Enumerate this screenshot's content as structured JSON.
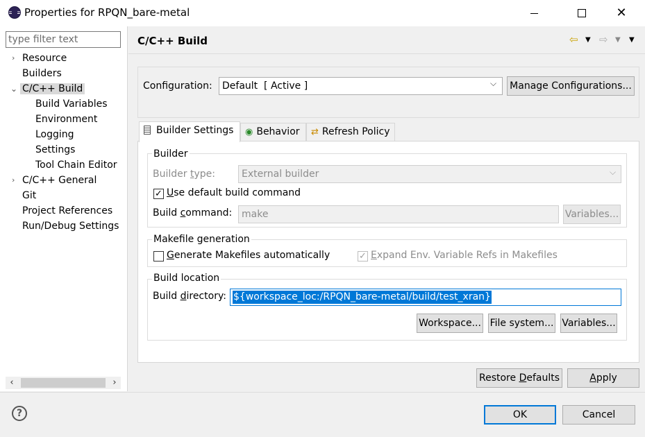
{
  "window": {
    "title": "Properties for RPQN_bare-metal",
    "minimize_icon": "minimize-icon",
    "maximize_icon": "maximize-icon",
    "close_icon": "close-icon"
  },
  "sidebar": {
    "filter_placeholder": "type filter text",
    "items": [
      {
        "label": "Resource",
        "expander": "collapsed"
      },
      {
        "label": "Builders"
      },
      {
        "label": "C/C++ Build",
        "expander": "expanded",
        "selected": true
      },
      {
        "label": "Build Variables"
      },
      {
        "label": "Environment"
      },
      {
        "label": "Logging"
      },
      {
        "label": "Settings"
      },
      {
        "label": "Tool Chain Editor"
      },
      {
        "label": "C/C++ General",
        "expander": "collapsed"
      },
      {
        "label": "Git"
      },
      {
        "label": "Project References"
      },
      {
        "label": "Run/Debug Settings"
      }
    ]
  },
  "page": {
    "title": "C/C++ Build"
  },
  "configuration": {
    "label": "Configuration:",
    "selected": "Default  [ Active ]",
    "manage_button": "Manage Configurations..."
  },
  "tabs": [
    {
      "label": "Builder Settings",
      "icon": "builder-settings-icon",
      "active": true
    },
    {
      "label": "Behavior",
      "icon": "behavior-icon"
    },
    {
      "label": "Refresh Policy",
      "icon": "refresh-policy-icon"
    }
  ],
  "builder": {
    "group_title": "Builder",
    "type_label_pre": "Builder ",
    "type_label_u": "t",
    "type_label_post": "ype:",
    "type_value": "External builder",
    "use_default_pre": "",
    "use_default_u": "U",
    "use_default_post": "se default build command",
    "use_default_checked": true,
    "command_label_pre": "Build ",
    "command_label_u": "c",
    "command_label_post": "ommand:",
    "command_value": "make",
    "variables_button": "Variables..."
  },
  "makefile": {
    "group_title": "Makefile generation",
    "generate_u": "G",
    "generate_post": "enerate Makefiles automatically",
    "generate_checked": false,
    "expand_u": "E",
    "expand_post": "xpand Env. Variable Refs in Makefiles",
    "expand_checked": true
  },
  "location": {
    "group_title": "Build location",
    "dir_label_pre": "Build ",
    "dir_label_u": "d",
    "dir_label_post": "irectory:",
    "dir_value": "${workspace_loc:/RPQN_bare-metal/build/test_xran}",
    "workspace_button": "Workspace...",
    "filesystem_button": "File system...",
    "variables_button": "Variables..."
  },
  "actions": {
    "restore_pre": "Restore ",
    "restore_u": "D",
    "restore_post": "efaults",
    "apply_u": "A",
    "apply_post": "pply",
    "ok": "OK",
    "cancel": "Cancel"
  },
  "colors": {
    "accent": "#0078d7",
    "selection_bg": "#0078d7"
  }
}
